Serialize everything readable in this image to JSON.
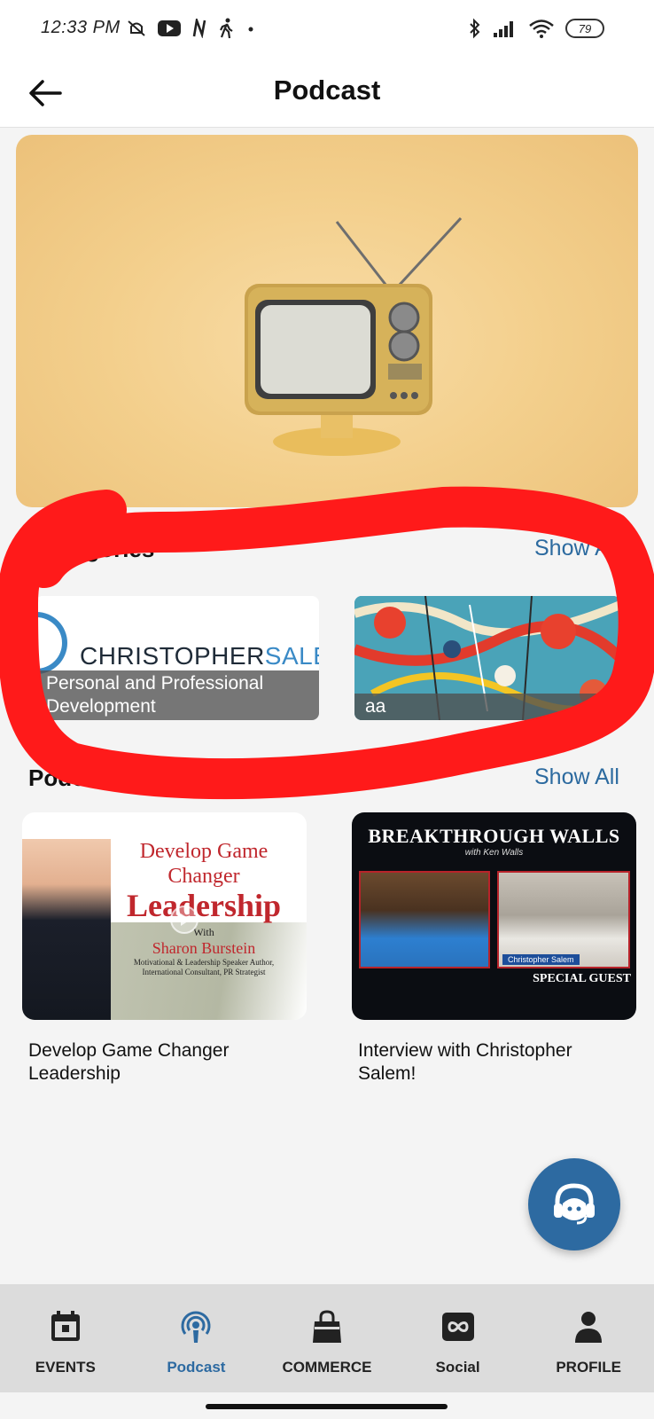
{
  "status_bar": {
    "time": "12:33 PM",
    "battery": "79",
    "left_icons": [
      "mute-icon",
      "youtube-icon",
      "n-icon",
      "walking-icon",
      "dot-icon"
    ],
    "right_icons": [
      "bluetooth-icon",
      "signal-icon",
      "wifi-icon",
      "battery-icon"
    ]
  },
  "header": {
    "title": "Podcast",
    "back_icon": "arrow-left-icon"
  },
  "categories": {
    "title": "Categories",
    "show_all": "Show All",
    "items": [
      {
        "label": "Personal and Professional Development",
        "brand_text": "CHRISTOPHER",
        "brand_accent": "SALEM"
      },
      {
        "label": "aa"
      }
    ]
  },
  "podcasts": {
    "title": "Podcasts",
    "show_all": "Show All",
    "items": [
      {
        "title": "Develop Game Changer Leadership",
        "thumb": {
          "line1": "Develop Game Changer",
          "line2": "Leadership",
          "with": "With",
          "name": "Sharon Burstein",
          "sub": "Motivational & Leadership Speaker Author, International Consultant, PR Strategist"
        }
      },
      {
        "title": "Interview with Christopher Salem!",
        "thumb": {
          "headline": "BREAKTHROUGH WALLS",
          "sub": "with Ken Walls",
          "guest": "Christopher Salem",
          "special": "SPECIAL GUEST"
        }
      }
    ]
  },
  "bottom_nav": {
    "items": [
      {
        "label": "EVENTS",
        "icon": "calendar-icon",
        "active": false
      },
      {
        "label": "Podcast",
        "icon": "podcast-icon",
        "active": true
      },
      {
        "label": "COMMERCE",
        "icon": "shopping-bag-icon",
        "active": false
      },
      {
        "label": "Social",
        "icon": "infinity-icon",
        "active": false
      },
      {
        "label": "PROFILE",
        "icon": "person-icon",
        "active": false
      }
    ]
  },
  "colors": {
    "accent": "#2d6aa1",
    "link": "#2c6a9f",
    "annotation": "#ff1a1a",
    "nav_bg": "#dcdcdc",
    "hero_bg": "#f3cf8c"
  }
}
